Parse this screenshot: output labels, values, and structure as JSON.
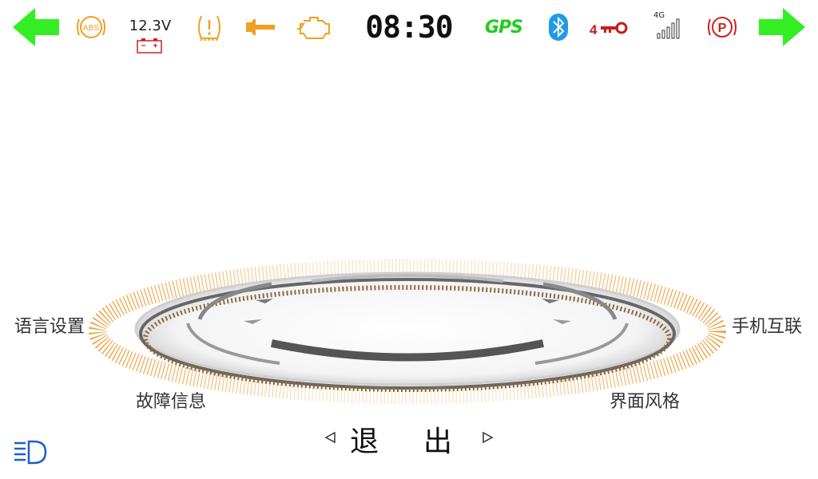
{
  "status_bar": {
    "time": "08:30",
    "voltage": "12.3V",
    "gps": "GPS",
    "network": "4G",
    "abs_label": "ABS",
    "parking_label": "P",
    "key_count": "4",
    "icons": {
      "left_turn": "arrow-left-icon",
      "abs": "abs-warning-icon",
      "battery": "battery-icon",
      "tire_pressure": "tire-pressure-icon",
      "wrench": "wrench-icon",
      "engine": "engine-check-icon",
      "gps": "gps-icon",
      "bluetooth": "bluetooth-icon",
      "key": "key-icon",
      "signal": "signal-bars-icon",
      "parking_brake": "parking-brake-icon",
      "right_turn": "arrow-right-icon"
    },
    "colors": {
      "turn_signal": "#33ee22",
      "warning": "#f0a020",
      "gps": "#22cc22",
      "bluetooth": "#1e9be6",
      "key": "#c81a1a",
      "parking": "#d02020"
    }
  },
  "menu": {
    "language": "语言设置",
    "phone_link": "手机互联",
    "fault_info": "故障信息",
    "ui_style": "界面风格",
    "exit": "退出"
  },
  "bottom": {
    "headlight_icon": "headlight-icon",
    "headlight_color": "#1a5fd0"
  }
}
